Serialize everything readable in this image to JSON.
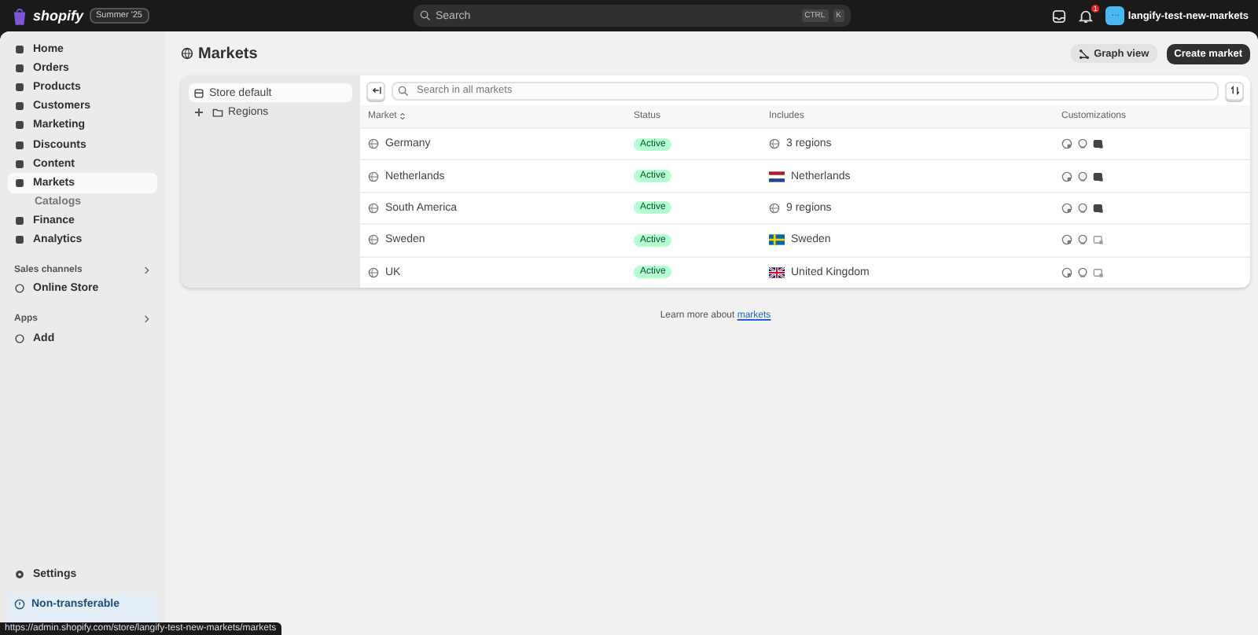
{
  "topbar": {
    "brand": "shopify",
    "badge": "Summer '25",
    "search": {
      "placeholder": "Search"
    },
    "shortcut": [
      "CTRL",
      "K"
    ],
    "notifications": "1",
    "avatar": "···",
    "store": "langify-test-new-markets"
  },
  "sidebar": {
    "items": [
      {
        "label": "Home",
        "selected": false
      },
      {
        "label": "Orders",
        "selected": false
      },
      {
        "label": "Products",
        "selected": false
      },
      {
        "label": "Customers",
        "selected": false
      },
      {
        "label": "Marketing",
        "selected": false
      },
      {
        "label": "Discounts",
        "selected": false
      },
      {
        "label": "Content",
        "selected": false
      },
      {
        "label": "Markets",
        "selected": true,
        "children": [
          {
            "label": "Catalogs",
            "selected": false
          }
        ]
      },
      {
        "label": "Finance",
        "selected": false
      },
      {
        "label": "Analytics",
        "selected": false
      }
    ],
    "sections": [
      {
        "title": "Sales channels",
        "items": [
          "Online Store"
        ]
      },
      {
        "title": "Apps",
        "items": [
          "Add"
        ]
      }
    ],
    "settings": "Settings",
    "notice": "Non-transferable"
  },
  "page": {
    "title": "Markets",
    "graph_button": "Graph view",
    "create_button": "Create market"
  },
  "tree": [
    {
      "label": "Store default",
      "selected": true
    },
    {
      "label": "Regions",
      "selected": false,
      "expanded": false
    }
  ],
  "table": {
    "search": {
      "placeholder": "Search in all markets"
    },
    "columns": [
      "Market",
      "Status",
      "Includes",
      "Customizations"
    ],
    "rows": [
      {
        "market": "Germany",
        "status": "Active",
        "includes": "3 regions",
        "kind": "regions",
        "store_custom": true
      },
      {
        "market": "Netherlands",
        "status": "Active",
        "includes": "Netherlands",
        "kind": "nl",
        "store_custom": true
      },
      {
        "market": "South America",
        "status": "Active",
        "includes": "9 regions",
        "kind": "regions",
        "store_custom": true
      },
      {
        "market": "Sweden",
        "status": "Active",
        "includes": "Sweden",
        "kind": "se",
        "store_custom": false
      },
      {
        "market": "UK",
        "status": "Active",
        "includes": "United Kingdom",
        "kind": "uk",
        "store_custom": false
      }
    ]
  },
  "footer": {
    "text": "Learn more about ",
    "link": "markets"
  },
  "status_bar": "https://admin.shopify.com/store/langify-test-new-markets/markets"
}
